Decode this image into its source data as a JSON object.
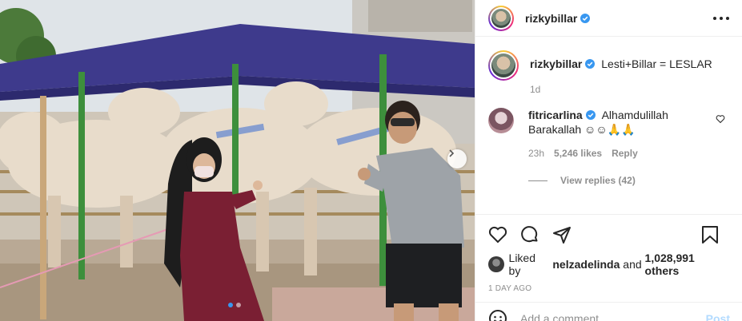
{
  "post": {
    "username": "rizkybillar",
    "verified_icon": "verified-badge-icon",
    "more_icon": "more-options-icon"
  },
  "caption": {
    "username": "rizkybillar",
    "text": "Lesti+Billar = LESLAR",
    "age": "1d"
  },
  "comments": [
    {
      "username": "fitricarlina",
      "text": "Alhamdulillah Barakallah ☺☺🙏🙏",
      "age": "23h",
      "likes": "5,246 likes",
      "reply_label": "Reply",
      "view_replies": "View replies (42)"
    }
  ],
  "actions": {
    "icons": [
      "heart-icon",
      "comment-icon",
      "share-icon",
      "bookmark-icon"
    ],
    "liked_by_prefix": "Liked by",
    "liked_by_user": "nelzadelinda",
    "liked_by_and": "and",
    "liked_by_others": "1,028,991 others",
    "timestamp": "1 DAY AGO"
  },
  "comment_box": {
    "placeholder": "Add a comment...",
    "post_label": "Post"
  },
  "carousel": {
    "slides": 2,
    "current": 1
  },
  "colors": {
    "verified": "#3897f0",
    "post_disabled": "#b3dbff",
    "tarp": "#3e3a8c"
  }
}
